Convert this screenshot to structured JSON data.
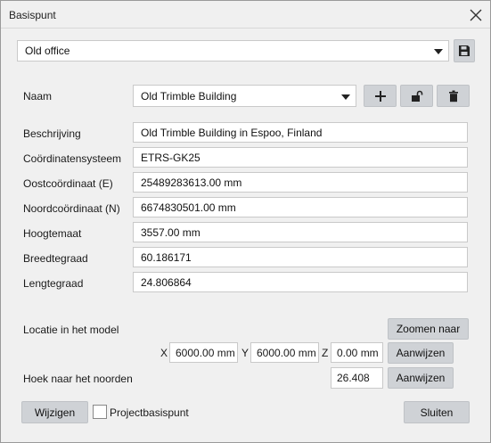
{
  "window": {
    "title": "Basispunt"
  },
  "preset": {
    "value": "Old office"
  },
  "form": {
    "naam_label": "Naam",
    "naam_value": "Old Trimble Building",
    "beschrijving_label": "Beschrijving",
    "beschrijving_value": "Old Trimble Building in Espoo, Finland",
    "coordsys_label": "Coördinatensysteem",
    "coordsys_value": "ETRS-GK25",
    "oost_label": "Oostcoördinaat  (E)",
    "oost_value": "25489283613.00 mm",
    "noord_label": "Noordcoördinaat  (N)",
    "noord_value": "6674830501.00 mm",
    "hoogte_label": "Hoogtemaat",
    "hoogte_value": "3557.00 mm",
    "breedte_label": "Breedtegraad",
    "breedte_value": "60.186171",
    "lengte_label": "Lengtegraad",
    "lengte_value": "24.806864"
  },
  "location": {
    "label": "Locatie in het model",
    "zoom_button": "Zoomen naar",
    "x_label": "X",
    "x_value": "6000.00 mm",
    "y_label": "Y",
    "y_value": "6000.00 mm",
    "z_label": "Z",
    "z_value": "0.00 mm",
    "pick_button": "Aanwijzen"
  },
  "north": {
    "label": "Hoek naar het noorden",
    "value": "26.408",
    "pick_button": "Aanwijzen"
  },
  "footer": {
    "modify_button": "Wijzigen",
    "project_checkbox_label": "Projectbasispunt",
    "project_checked": false,
    "close_button": "Sluiten"
  },
  "icons": {
    "close": "close-icon",
    "save": "floppy-disk-icon",
    "add": "plus-icon",
    "lock": "unlock-icon",
    "delete": "trash-icon",
    "dropdown": "chevron-down-icon"
  }
}
